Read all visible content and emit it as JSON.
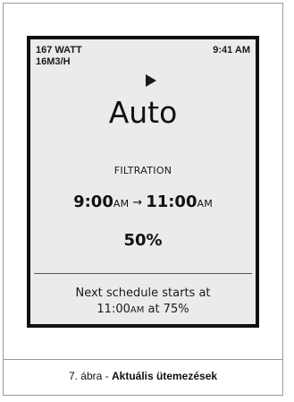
{
  "status": {
    "power": "167 WATT",
    "flow": "16M3/H",
    "time": "9:41 AM"
  },
  "main": {
    "play_icon": "play-icon",
    "mode": "Auto",
    "section_label": "FILTRATION",
    "start_time": "9:00",
    "start_ampm": "AM",
    "arrow": "→",
    "end_time": "11:00",
    "end_ampm": "AM",
    "speed_percent": "50%"
  },
  "next_schedule": {
    "line1": "Next schedule starts at",
    "time": "11:00",
    "ampm": "AM",
    "suffix": " at 75%"
  },
  "caption": {
    "prefix": "7. ábra - ",
    "title": "Aktuális ütemezések"
  }
}
